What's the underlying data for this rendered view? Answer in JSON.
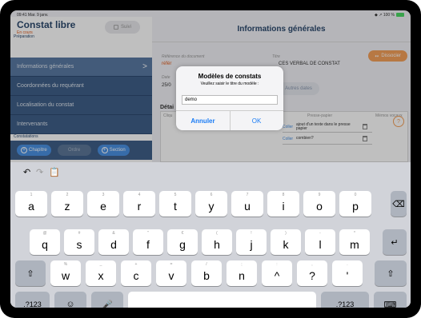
{
  "status_bar": {
    "time": "09:41 Mar. 9 janv.",
    "right": "◆ ↗ 100 %"
  },
  "sidebar": {
    "app_title": "Constat libre",
    "status": "En cours",
    "suivi_label": "Suivi",
    "section_preparation": "Préparation",
    "items": [
      {
        "label": "Informations générales"
      },
      {
        "label": "Coordonnées du requérant"
      },
      {
        "label": "Localisation du constat"
      },
      {
        "label": "Intervenants"
      }
    ],
    "section_constatations": "Constatations",
    "chapitre_label": "Chapitre",
    "ordre_label": "Ordre",
    "section_label": "Section"
  },
  "main": {
    "title": "Informations générales",
    "dissocier_label": "Dissocier",
    "ref_label": "Référence du document",
    "ref_value": "référ",
    "titre_label": "Titre",
    "titre_value": "CES VERBAL DE CONSTAT",
    "date_label": "Date",
    "date_value": "25/0",
    "autres_dates": "Autres dates",
    "details_label": "Détai",
    "col_clique": "Cliqu",
    "col_presse": "Presse-papier",
    "col_memos": "Mémos vocaux",
    "clipboard": [
      {
        "coller": "Coller",
        "text": "ajout d'un texte dans le presse papier"
      },
      {
        "coller": "Coller",
        "text": "combien?"
      }
    ],
    "help": "?"
  },
  "dialog": {
    "title": "Modèles de constats",
    "message": "Veuillez saisir le titre du modèle :",
    "input_value": "demo",
    "cancel_label": "Annuler",
    "ok_label": "OK"
  },
  "keyboard": {
    "toolbar": {
      "undo_icon": "undo-icon",
      "redo_icon": "redo-icon",
      "paste_icon": "paste-icon"
    },
    "row1": [
      {
        "hint": "1",
        "char": "a"
      },
      {
        "hint": "2",
        "char": "z"
      },
      {
        "hint": "3",
        "char": "e"
      },
      {
        "hint": "4",
        "char": "r"
      },
      {
        "hint": "5",
        "char": "t"
      },
      {
        "hint": "6",
        "char": "y"
      },
      {
        "hint": "7",
        "char": "u"
      },
      {
        "hint": "8",
        "char": "i"
      },
      {
        "hint": "9",
        "char": "o"
      },
      {
        "hint": "0",
        "char": "p"
      }
    ],
    "row2": [
      {
        "hint": "@",
        "char": "q"
      },
      {
        "hint": "#",
        "char": "s"
      },
      {
        "hint": "&",
        "char": "d"
      },
      {
        "hint": "\"",
        "char": "f"
      },
      {
        "hint": "€",
        "char": "g"
      },
      {
        "hint": "(",
        "char": "h"
      },
      {
        "hint": "!",
        "char": "j"
      },
      {
        "hint": ")",
        "char": "k"
      },
      {
        "hint": "-",
        "char": "l"
      },
      {
        "hint": "*",
        "char": "m"
      }
    ],
    "row3": [
      {
        "hint": "%",
        "char": "w"
      },
      {
        "hint": "_",
        "char": "x"
      },
      {
        "hint": "+",
        "char": "c"
      },
      {
        "hint": "=",
        "char": "v"
      },
      {
        "hint": "/",
        "char": "b"
      },
      {
        "hint": ";",
        "char": "n"
      },
      {
        "hint": ":",
        "char": "^"
      },
      {
        "hint": ",",
        "char": "?"
      },
      {
        "hint": ".",
        "char": "'"
      }
    ],
    "numbers_label": ".?123",
    "numbers_label_right": ".?123"
  }
}
